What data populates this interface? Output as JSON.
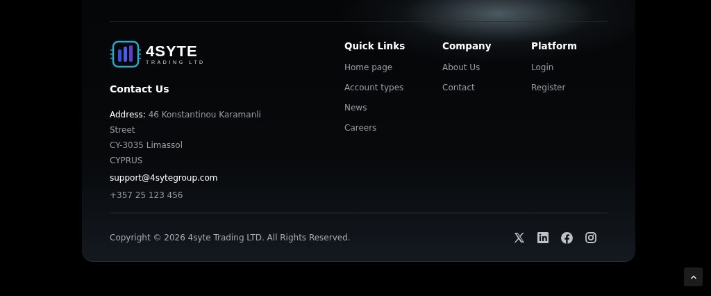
{
  "logo": {
    "name": "4SYTE",
    "tagline": "TRADING LTD"
  },
  "contact": {
    "title": "Contact Us",
    "address": "**Address:** 46 Konstantinou Karamanli Street",
    "address_lines": [
      "CY-3035 Limassol",
      "CYPRUS"
    ],
    "email": "support@4sytegroup.com",
    "phone": "+357 25 123 456"
  },
  "columns": [
    {
      "title": "Quick Links",
      "links": [
        "Home page",
        "Account types",
        "News",
        "Careers"
      ]
    },
    {
      "title": "Company",
      "links": [
        "About Us",
        "Contact"
      ]
    },
    {
      "title": "Platform",
      "links": [
        "Login",
        "Register"
      ]
    }
  ],
  "copyright": "Copyright © 2026 4syte Trading LTD. All Rights Reserved.",
  "social": [
    {
      "kind": "x"
    },
    {
      "kind": "linkedin"
    },
    {
      "kind": "facebook"
    },
    {
      "kind": "instagram"
    }
  ]
}
